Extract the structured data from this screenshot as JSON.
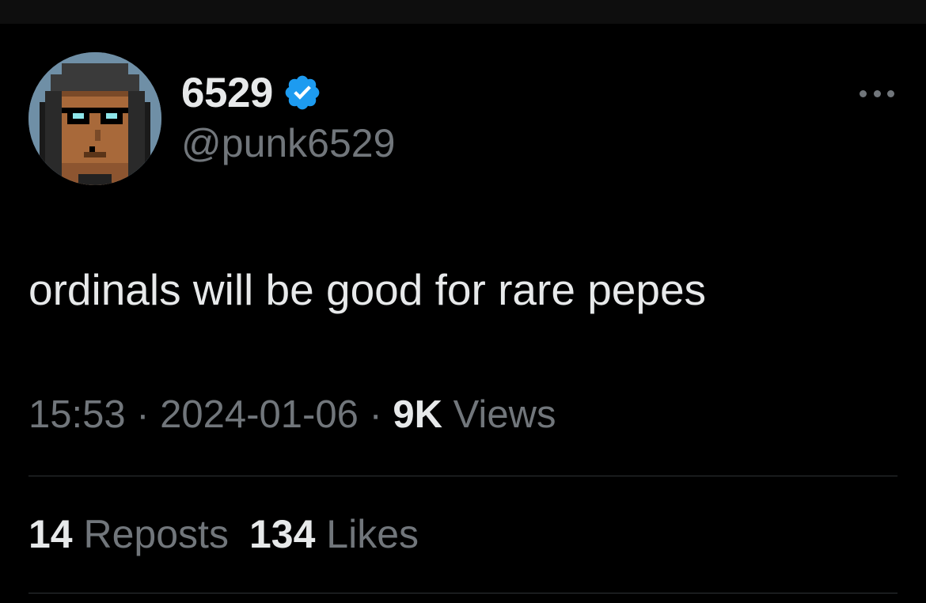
{
  "author": {
    "display_name": "6529",
    "handle": "@punk6529",
    "verified_icon": "verified-badge-icon",
    "avatar": "pixel-punk-avatar"
  },
  "tweet": {
    "text": "ordinals will be good for rare pepes"
  },
  "meta": {
    "time": "15:53",
    "separator_1": " · ",
    "date": "2024-01-06",
    "separator_2": " · ",
    "views_count": "9K",
    "views_label": " Views"
  },
  "stats": {
    "reposts_count": "14",
    "reposts_label": " Reposts",
    "likes_count": "134",
    "likes_label": " Likes"
  },
  "colors": {
    "background": "#000000",
    "primary_text": "#e7e9ea",
    "secondary_text": "#71767b",
    "verified_blue": "#1d9bf0",
    "divider": "#2f3336"
  },
  "menu": {
    "more_icon": "more-horizontal-icon"
  }
}
